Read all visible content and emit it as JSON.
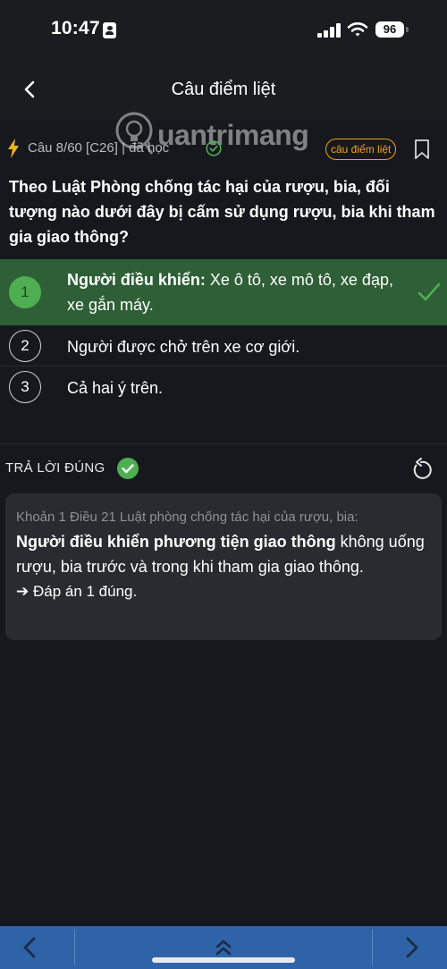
{
  "status_bar": {
    "time": "10:47",
    "battery": "96",
    "icons": [
      "id-card-icon",
      "signal-icon",
      "wifi-icon",
      "battery-icon"
    ]
  },
  "header": {
    "title": "Câu điểm liệt",
    "back_icon": "chevron-left-icon"
  },
  "meta": {
    "progress_text": "Câu 8/60 [C26] | đã học",
    "badge": "câu điểm liệt",
    "watermark": "uantrimang"
  },
  "question": {
    "text": "Theo Luật Phòng chống tác hại của rượu, bia, đối tượng nào dưới đây bị cấm sử dụng rượu, bia khi tham gia giao thông?"
  },
  "answers": [
    {
      "number": "1",
      "bold": "Người điều khiển:",
      "text": " Xe ô tô, xe mô tô, xe đạp, xe gắn máy.",
      "correct": true
    },
    {
      "number": "2",
      "text": " Người được chở trên xe cơ giới."
    },
    {
      "number": "3",
      "text": "Cả hai ý trên."
    }
  ],
  "result": {
    "label": "TRẢ LỜI ĐÚNG"
  },
  "explanation": {
    "reference": "Khoản 1 Điều 21 Luật phòng chống tác hại của rượu, bia:",
    "bold": "Người điều khiển phương tiện giao thông",
    "body": " không uống rượu, bia trước và trong khi tham gia giao thông.",
    "answer": "➔ Đáp án 1 đúng."
  },
  "colors": {
    "background": "#16181d",
    "correct_bg": "#2e5f36",
    "correct_accent": "#4fae52",
    "badge": "#f0a21a",
    "bottom_bar": "#2f63a8"
  }
}
